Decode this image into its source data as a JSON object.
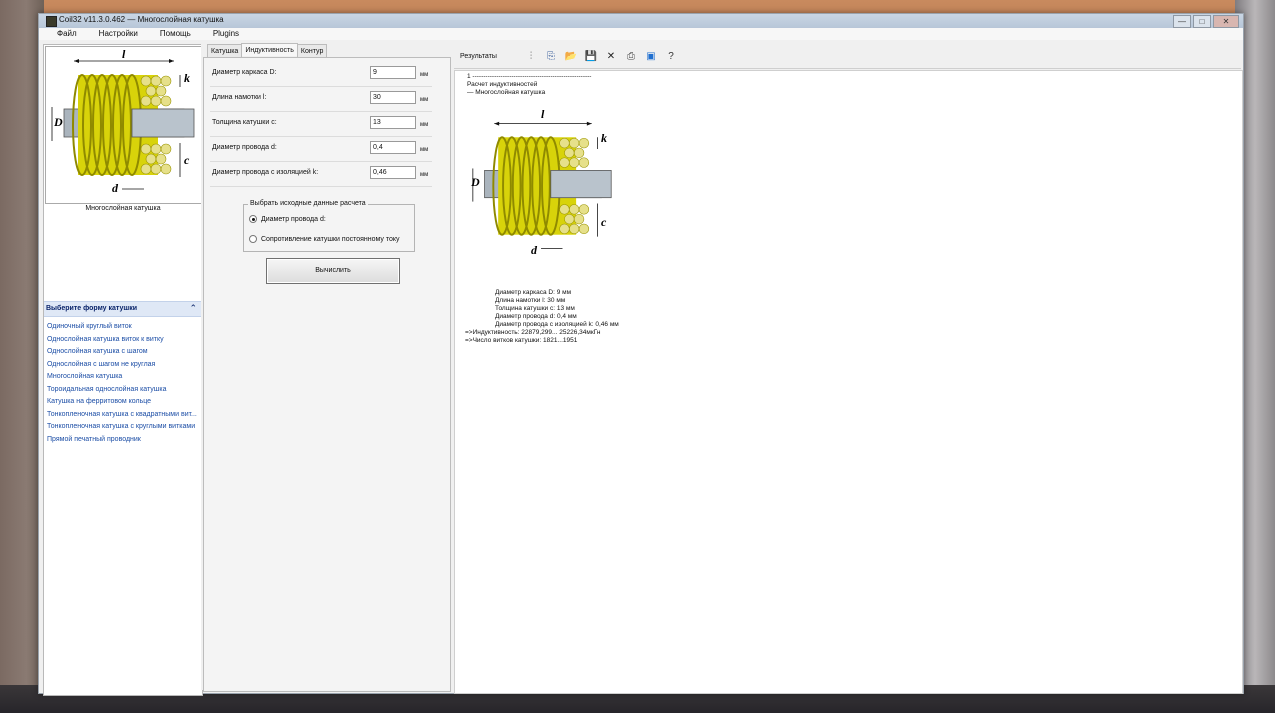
{
  "window": {
    "title": "Coil32 v11.3.0.462 — Многослойная катушка",
    "controls": {
      "minimize": "—",
      "maximize": "□",
      "close": "✕"
    }
  },
  "menu": [
    "Файл",
    "Настройки",
    "Помощь",
    "Plugins"
  ],
  "left": {
    "image_caption": "Многослойная катушка",
    "shape_header": "Выберите форму катушки",
    "shapes": [
      "Одиночный круглый виток",
      "Однослойная катушка виток к витку",
      "Однослойная катушка с шагом",
      "Однослойная с шагом не круглая",
      "Многослойная катушка",
      "Тороидальная однослойная катушка",
      "Катушка на ферритовом кольце",
      "Тонкопленочная катушка с квадратными вит...",
      "Тонкопленочная катушка с круглыми витками",
      "Прямой печатный проводник"
    ]
  },
  "tabs": [
    "Катушка",
    "Индуктивность",
    "Контур"
  ],
  "form": {
    "params": [
      {
        "label": "Диаметр каркаса D:",
        "value": "9",
        "unit": "мм"
      },
      {
        "label": "Длина намотки l:",
        "value": "30",
        "unit": "мм"
      },
      {
        "label": "Толщина катушки c:",
        "value": "13",
        "unit": "мм"
      },
      {
        "label": "Диаметр провода d:",
        "value": "0,4",
        "unit": "мм"
      },
      {
        "label": "Диаметр провода с изоляцией k:",
        "value": "0,46",
        "unit": "мм"
      }
    ],
    "group_title": "Выбрать исходные данные расчета",
    "radio": [
      "Диаметр провода d:",
      "Сопротивление катушки постоянному току"
    ],
    "calc_button": "Вычислить"
  },
  "diagram": {
    "l": "l",
    "k": "k",
    "D": "D",
    "c": "c",
    "d": "d"
  },
  "results": {
    "title": "Результаты",
    "lines": [
      "1 -------------------------------------------------------",
      "Расчет индуктивностей",
      "— Многослойная катушка",
      "Диаметр каркаса D: 9 мм",
      "Длина намотки l: 30 мм",
      "Толщина катушки c: 13 мм",
      "Диаметр провода d: 0,4 мм",
      "Диаметр провода с изоляцией k: 0,46 мм",
      "=>Индуктивность: 22879,299... 25226,34мкГн",
      "=>Число витков катушки: 1821...1951"
    ]
  },
  "colors": {
    "coil": "#d8d30a",
    "link": "#1c4ea6",
    "header_bg": "#dfe8f6"
  }
}
